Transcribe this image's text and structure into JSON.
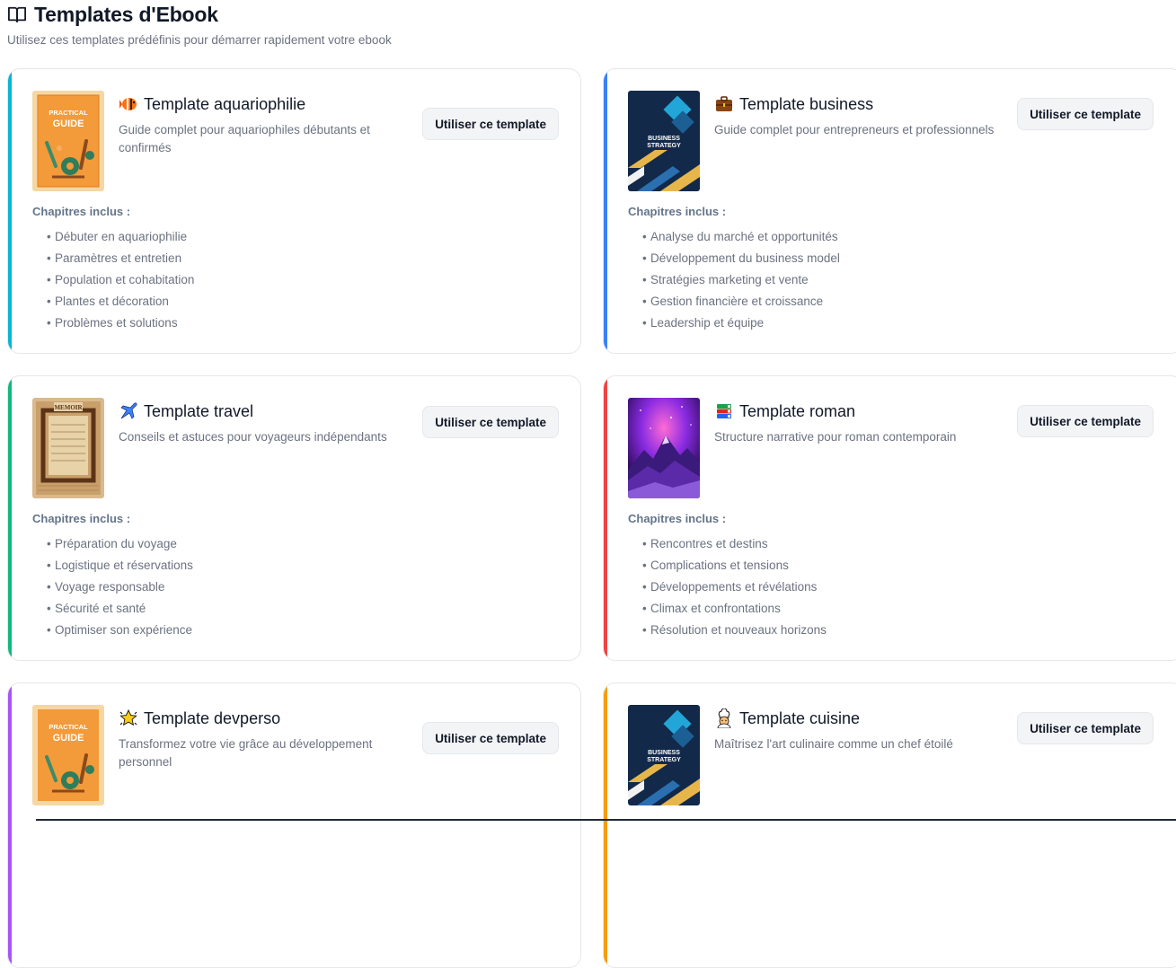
{
  "page": {
    "icon": "open-book-icon",
    "title": "Templates d'Ebook",
    "subtitle": "Utilisez ces templates prédéfinis pour démarrer rapidement votre ebook"
  },
  "common": {
    "button_label": "Utiliser ce template",
    "chapters_label": "Chapitres inclus :"
  },
  "colors": {
    "aquariophilie": "#06b6d4",
    "business": "#3b82f6",
    "travel": "#10b981",
    "roman": "#ef4444",
    "devperso": "#a855f7",
    "cuisine": "#f59e0b"
  },
  "templates": [
    {
      "id": "aquariophilie",
      "emoji": "tropical-fish-icon",
      "title": "Template aquariophilie",
      "description": "Guide complet pour aquariophiles débutants et confirmés",
      "cover": "practical-guide-cover",
      "cover_text": [
        "PRACTICAL",
        "GUIDE"
      ],
      "chapters": [
        "Débuter en aquariophilie",
        "Paramètres et entretien",
        "Population et cohabitation",
        "Plantes et décoration",
        "Problèmes et solutions"
      ]
    },
    {
      "id": "business",
      "emoji": "briefcase-icon",
      "title": "Template business",
      "description": "Guide complet pour entrepreneurs et professionnels",
      "cover": "business-strategy-cover",
      "cover_text": [
        "BUSINESS",
        "STRATEGY"
      ],
      "chapters": [
        "Analyse du marché et opportunités",
        "Développement du business model",
        "Stratégies marketing et vente",
        "Gestion financière et croissance",
        "Leadership et équipe"
      ]
    },
    {
      "id": "travel",
      "emoji": "airplane-icon",
      "title": "Template travel",
      "description": "Conseils et astuces pour voyageurs indépendants",
      "cover": "memoir-cover",
      "cover_text": [
        "MEMOIR"
      ],
      "chapters": [
        "Préparation du voyage",
        "Logistique et réservations",
        "Voyage responsable",
        "Sécurité et santé",
        "Optimiser son expérience"
      ]
    },
    {
      "id": "roman",
      "emoji": "books-icon",
      "title": "Template roman",
      "description": "Structure narrative pour roman contemporain",
      "cover": "galaxy-mountain-cover",
      "chapters": [
        "Rencontres et destins",
        "Complications et tensions",
        "Développements et révélations",
        "Climax et confrontations",
        "Résolution et nouveaux horizons"
      ]
    },
    {
      "id": "devperso",
      "emoji": "glowing-star-icon",
      "title": "Template devperso",
      "description": "Transformez votre vie grâce au développement personnel",
      "cover": "practical-guide-cover",
      "cover_text": [
        "PRACTICAL",
        "GUIDE"
      ],
      "chapters": []
    },
    {
      "id": "cuisine",
      "emoji": "chef-icon",
      "title": "Template cuisine",
      "description": "Maîtrisez l'art culinaire comme un chef étoilé",
      "cover": "business-strategy-cover",
      "cover_text": [
        "BUSINESS",
        "STRATEGY"
      ],
      "chapters": []
    }
  ]
}
